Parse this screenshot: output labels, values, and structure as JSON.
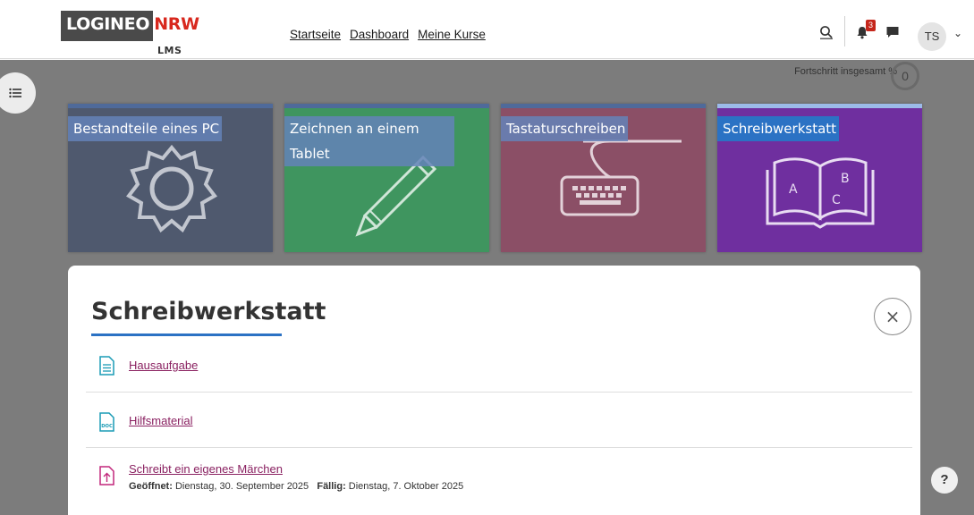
{
  "header": {
    "logo_part1": "LOGINEO",
    "logo_part2": "NRW",
    "logo_sub": "LMS",
    "nav": [
      {
        "label": "Startseite"
      },
      {
        "label": "Dashboard"
      },
      {
        "label": "Meine Kurse"
      }
    ],
    "notification_count": "3",
    "user_initials": "TS",
    "user_menu_caret": "⌄"
  },
  "course": {
    "progress_label": "Fortschritt insgesamt %",
    "progress_value": "0",
    "tiles": [
      {
        "title": "Bestandteile eines PC",
        "icon": "gear-icon",
        "color": "#4f596e"
      },
      {
        "title": "Zeichnen an einem Tablet",
        "icon": "pencil-icon",
        "color": "#3f955f"
      },
      {
        "title": "Tastaturschreiben",
        "icon": "keyboard-icon",
        "color": "#8b4f66"
      },
      {
        "title": "Schreibwerkstatt",
        "icon": "book-icon",
        "color": "#6f2f9f",
        "active": true
      }
    ]
  },
  "section": {
    "title": "Schreibwerkstatt",
    "close_label": "×",
    "activities": [
      {
        "name": "Hausaufgabe",
        "icon": "page-icon"
      },
      {
        "name": "Hilfsmaterial",
        "icon": "doc-file-icon",
        "icon_text": "DOC"
      },
      {
        "name": "Schreibt ein eigenes Märchen",
        "icon": "assignment-icon",
        "opened_label": "Geöffnet:",
        "opened_value": "Dienstag, 30. September 2025",
        "due_label": "Fällig:",
        "due_value": "Dienstag, 7. Oktober 2025"
      }
    ]
  },
  "help_label": "?",
  "colors": {
    "accent": "#2b72c4",
    "link": "#8a2161",
    "overlay": "#7c7c7c",
    "badge": "#c5261b"
  }
}
